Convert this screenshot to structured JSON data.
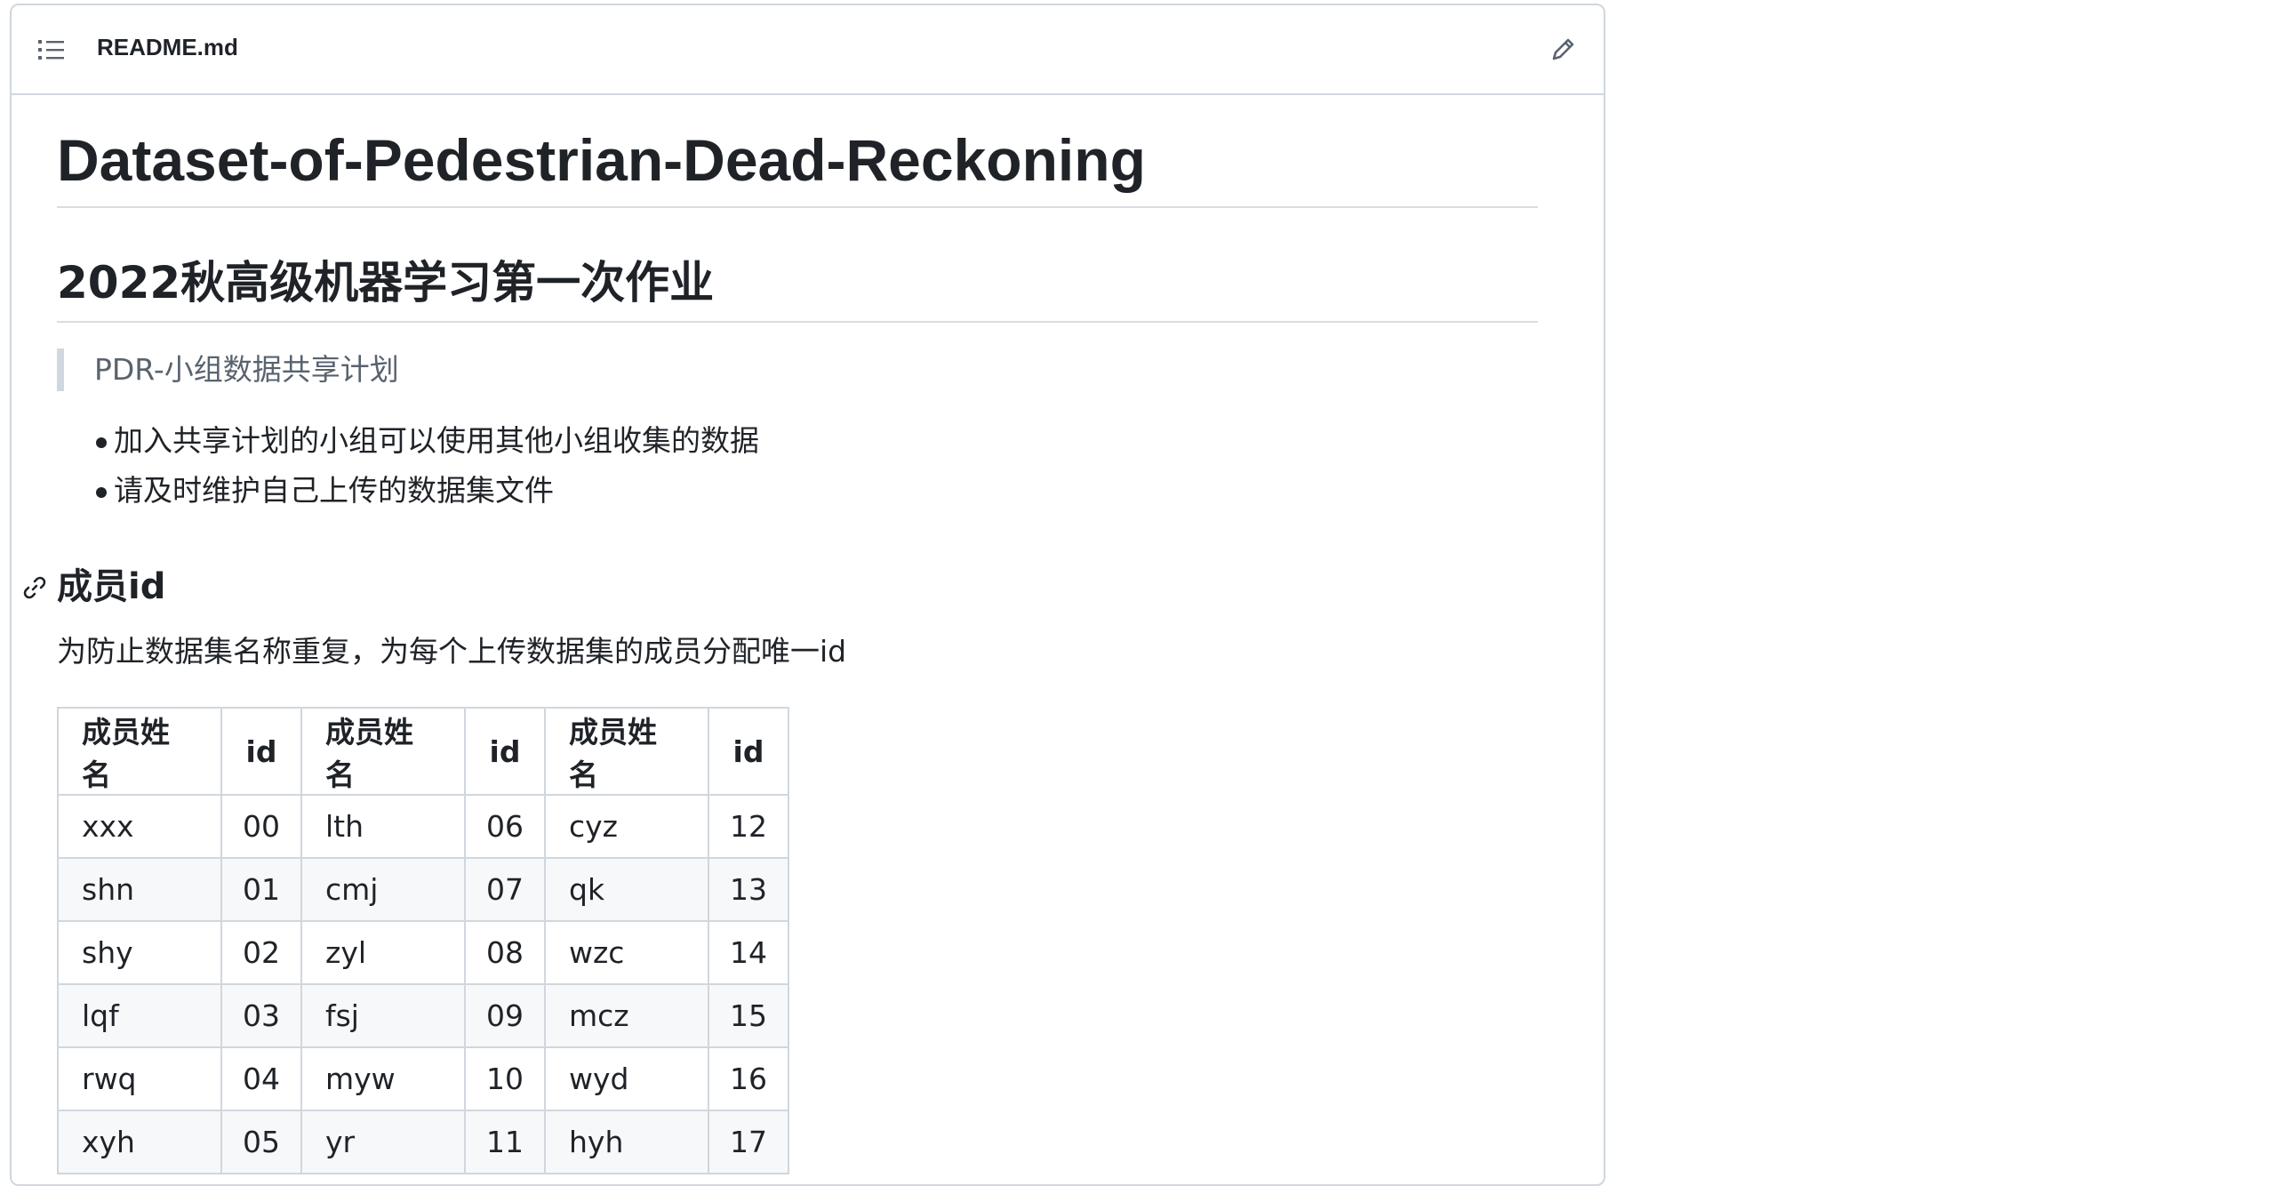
{
  "header": {
    "file_name": "README.md",
    "toc_icon": "list-unordered-icon",
    "edit_icon": "pencil-icon"
  },
  "readme": {
    "title": "Dataset-of-Pedestrian-Dead-Reckoning",
    "subtitle": "2022秋高级机器学习第一次作业",
    "quote": "PDR-小组数据共享计划",
    "bullets": [
      "加入共享计划的小组可以使用其他小组收集的数据",
      "请及时维护自己上传的数据集文件"
    ],
    "section_heading": "成员id",
    "section_anchor_icon": "link-icon",
    "description": "为防止数据集名称重复，为每个上传数据集的成员分配唯一id"
  },
  "table": {
    "headers": [
      "成员姓名",
      "id",
      "成员姓名",
      "id",
      "成员姓名",
      "id"
    ],
    "rows": [
      [
        "xxx",
        "00",
        "lth",
        "06",
        "cyz",
        "12"
      ],
      [
        "shn",
        "01",
        "cmj",
        "07",
        "qk",
        "13"
      ],
      [
        "shy",
        "02",
        "zyl",
        "08",
        "wzc",
        "14"
      ],
      [
        "lqf",
        "03",
        "fsj",
        "09",
        "mcz",
        "15"
      ],
      [
        "rwq",
        "04",
        "myw",
        "10",
        "wyd",
        "16"
      ],
      [
        "xyh",
        "05",
        "yr",
        "11",
        "hyh",
        "17"
      ]
    ]
  },
  "colors": {
    "text": "#1f2328",
    "muted": "#59636e",
    "border": "#d0d7de",
    "stripe": "#f6f8fa"
  }
}
